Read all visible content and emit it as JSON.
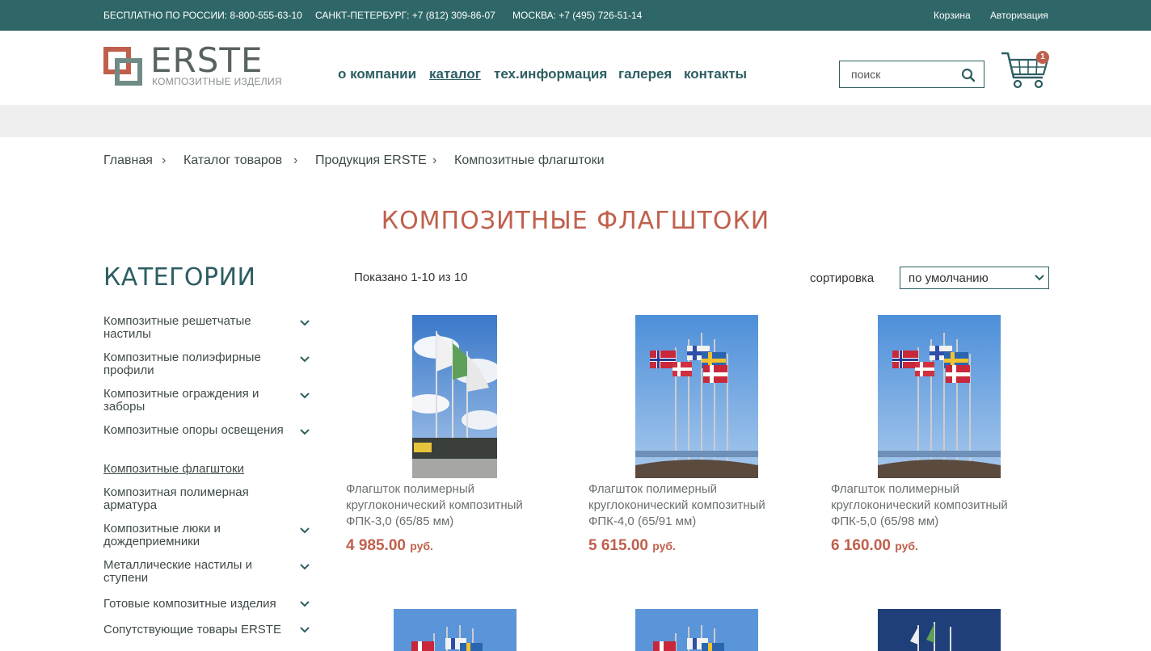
{
  "topbar": {
    "phone_russia": "БЕСПЛАТНО ПО РОССИИ: 8-800-555-63-10",
    "phone_spb": "САНКТ-ПЕТЕРБУРГ: +7 (812) 309-86-07",
    "phone_msk": "МОСКВА: +7 (495) 726-51-14",
    "cart_link": "Корзина",
    "auth_link": "Авторизация"
  },
  "logo": {
    "word": "ERSTE",
    "subtitle": "КОМПОЗИТНЫЕ ИЗДЕЛИЯ"
  },
  "nav": {
    "about": "о компании",
    "catalog": "каталог",
    "techinfo": "тех.информация",
    "gallery": "галерея",
    "contacts": "контакты"
  },
  "search": {
    "placeholder": "поиск"
  },
  "cart": {
    "count": "1"
  },
  "breadcrumb": [
    "Главная",
    "Каталог товаров",
    "Продукция ERSTE",
    "Композитные флагштоки"
  ],
  "breadcrumb_sep": "›",
  "page_title": "КОМПОЗИТНЫЕ ФЛАГШТОКИ",
  "sidebar": {
    "title": "КАТЕГОРИИ",
    "items": [
      {
        "label": "Композитные решетчатые настилы",
        "expandable": true
      },
      {
        "label": "Композитные полиэфирные профили",
        "expandable": true
      },
      {
        "label": "Композитные ограждения и заборы",
        "expandable": true
      },
      {
        "label": "Композитные опоры освещения",
        "expandable": true
      },
      {
        "label": "Композитные флагштоки",
        "expandable": false,
        "active": true
      },
      {
        "label": "Композитная полимерная арматура",
        "expandable": false
      },
      {
        "label": "Композитные люки и дождеприемники",
        "expandable": true
      },
      {
        "label": "Металлические настилы и ступени",
        "expandable": true
      },
      {
        "label": "Готовые композитные изделия",
        "expandable": true
      },
      {
        "label": "Сопутствующие товары ERSTE",
        "expandable": true
      }
    ]
  },
  "listing": {
    "shown": "Показано 1-10 из 10",
    "sort_label": "сортировка",
    "sort_value": "по умолчанию"
  },
  "products": [
    {
      "name": "Флагшток полимерный круглоконический композитный ФПК-3,0 (65/85 мм)",
      "price": "4 985.00",
      "currency": "руб."
    },
    {
      "name": "Флагшток полимерный круглоконический композитный ФПК-4,0 (65/91 мм)",
      "price": "5 615.00",
      "currency": "руб."
    },
    {
      "name": "Флагшток полимерный круглоконический композитный ФПК-5,0 (65/98 мм)",
      "price": "6 160.00",
      "currency": "руб."
    }
  ],
  "colors": {
    "topbar": "#2f6768",
    "accent": "#c0604c",
    "nav": "#2d5e62"
  }
}
